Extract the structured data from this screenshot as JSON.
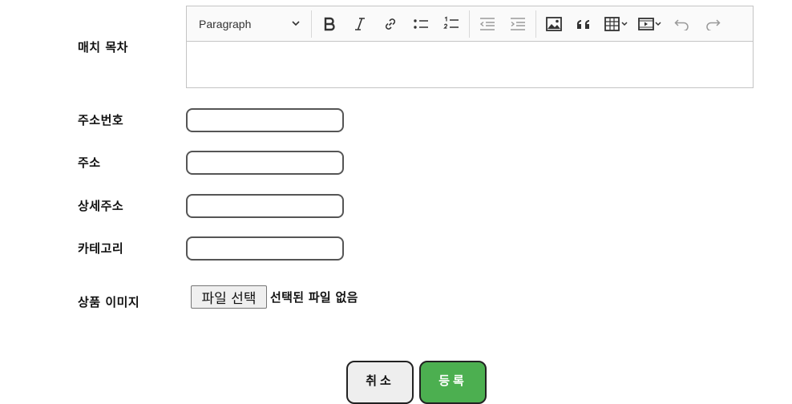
{
  "fields": {
    "toc_label": "매치 목차",
    "zipcode_label": "주소번호",
    "address_label": "주소",
    "detail_address_label": "상세주소",
    "category_label": "카테고리",
    "image_label": "상품 이미지"
  },
  "editor": {
    "heading_select": "Paragraph",
    "toolbar_icons": [
      "bold-icon",
      "italic-icon",
      "link-icon",
      "bulleted-list-icon",
      "numbered-list-icon",
      "outdent-icon",
      "indent-icon",
      "image-icon",
      "blockquote-icon",
      "table-icon",
      "media-icon",
      "undo-icon",
      "redo-icon"
    ]
  },
  "inputs": {
    "zipcode_value": "",
    "address_value": "",
    "detail_address_value": "",
    "category_value": ""
  },
  "file_input": {
    "button_label": "파일 선택",
    "status": "선택된 파일 없음"
  },
  "buttons": {
    "cancel": "취소",
    "submit": "등록"
  },
  "colors": {
    "submit_bg": "#4caf50",
    "cancel_bg": "#eeeeee"
  }
}
